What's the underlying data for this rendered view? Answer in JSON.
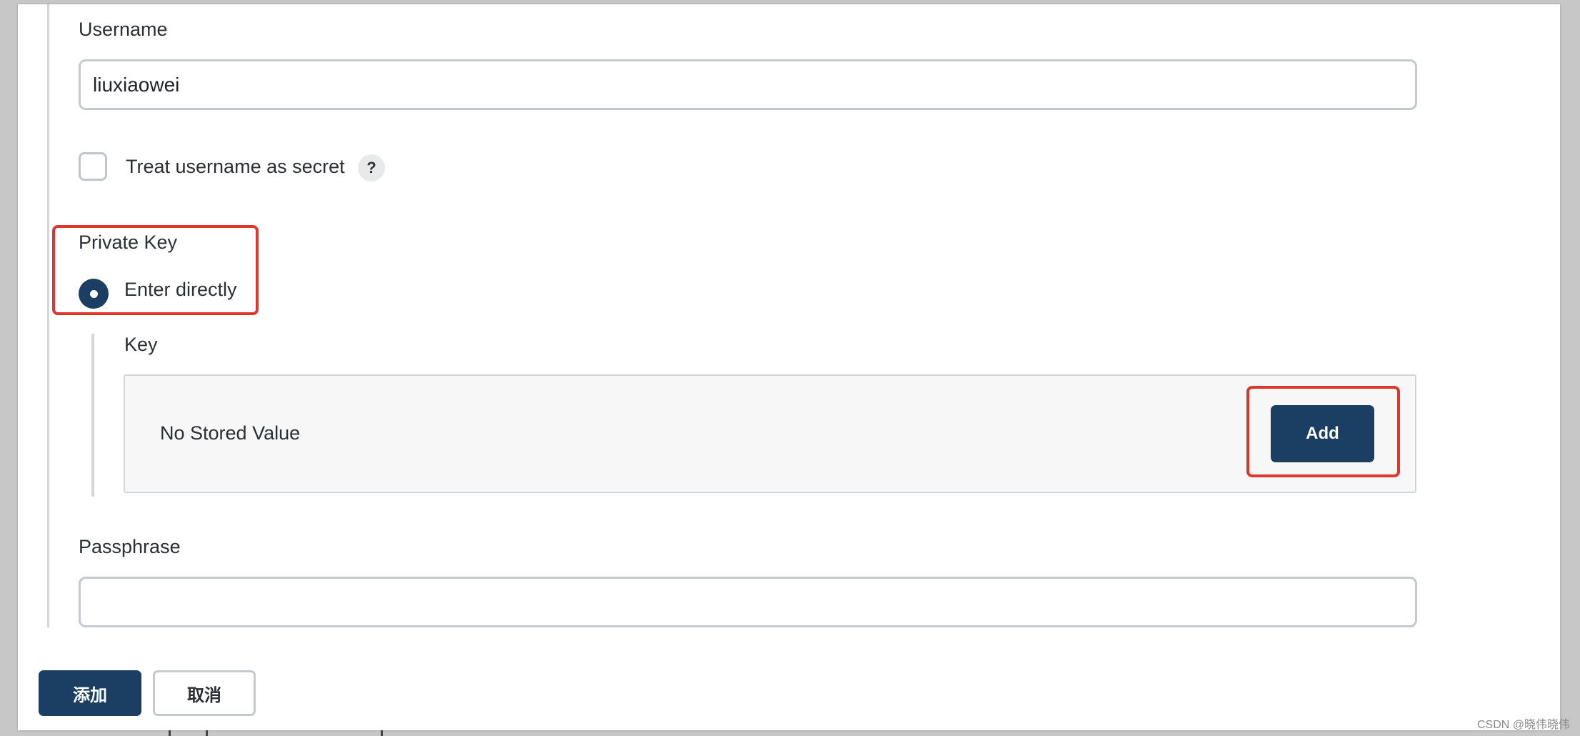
{
  "form": {
    "username_label": "Username",
    "username_value": "liuxiaowei",
    "treat_secret_label": "Treat username as secret",
    "treat_secret_checked": false,
    "help_symbol": "?",
    "private_key_label": "Private Key",
    "enter_directly_label": "Enter directly",
    "enter_directly_selected": true,
    "key_label": "Key",
    "no_stored_value": "No Stored Value",
    "add_button": "Add",
    "passphrase_label": "Passphrase",
    "passphrase_value": ""
  },
  "footer": {
    "confirm_button": "添加",
    "cancel_button": "取消"
  },
  "watermark": "CSDN @晓伟晓伟",
  "colors": {
    "primary": "#1b3f62",
    "highlight": "#e0352b",
    "border": "#c3c9ce"
  }
}
